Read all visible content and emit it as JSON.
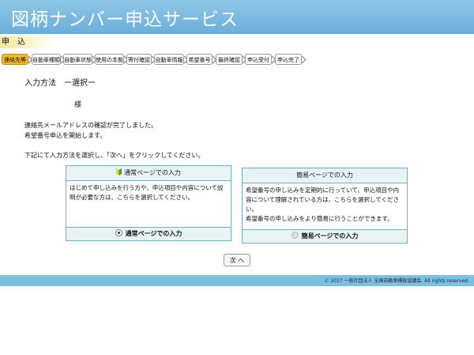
{
  "header": {
    "title": "図柄ナンバー申込サービス"
  },
  "section_label": "申　込",
  "steps": [
    {
      "label": "連絡先等",
      "active": true
    },
    {
      "label": "自動車種類",
      "active": false
    },
    {
      "label": "自動車状態",
      "active": false
    },
    {
      "label": "使用の本拠",
      "active": false
    },
    {
      "label": "寄付確認",
      "active": false
    },
    {
      "label": "自動車情報",
      "active": false
    },
    {
      "label": "希望番号",
      "active": false
    },
    {
      "label": "最終確認",
      "active": false
    },
    {
      "label": "申込受付",
      "active": false
    },
    {
      "label": "申込完了",
      "active": false
    }
  ],
  "main": {
    "page_title": "入力方法　ー選択ー",
    "user_suffix": "様",
    "message_line1": "連絡先メールアドレスの確認が完了しました。",
    "message_line2": "希望番号申込を開始します。",
    "instruction": "下記にて入力方法を選択し、「次へ」をクリックしてください。"
  },
  "options": {
    "normal": {
      "heading": "通常ページでの入力",
      "description": "はじめて申し込みを行う方や、申込項目や内容について説明が必要な方は、こちらを選択してください。",
      "radio_label": "通常ページでの入力",
      "selected": true
    },
    "simple": {
      "heading": "簡易ページでの入力",
      "description": "希望番号の申し込みを定期的に行っていて、申込項目や内容について理解されている方は、こちらを選択してください。\n希望番号の申し込みをより簡易に行うことができます。",
      "radio_label": "簡易ページでの入力",
      "selected": false
    }
  },
  "next_button": "次 へ",
  "footer": {
    "copyright": "© 2017 一般社団法人 全国自動車標板協議会. All rights reserved."
  },
  "colors": {
    "header": "#7ab8e0",
    "active_step": "#f6b92a",
    "card_border": "#6fb0c8",
    "footer": "#7cc0df"
  }
}
